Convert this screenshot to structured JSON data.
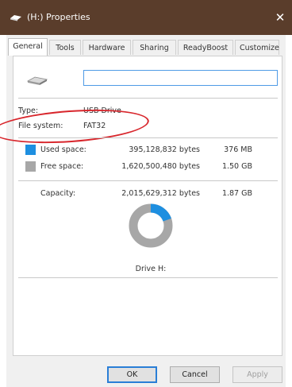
{
  "window": {
    "title": "(H:) Properties",
    "close_glyph": "✕",
    "icon": "drive-icon",
    "titlebar_color": "#5a3d2b"
  },
  "tabs": [
    {
      "label": "General",
      "active": true
    },
    {
      "label": "Tools"
    },
    {
      "label": "Hardware"
    },
    {
      "label": "Sharing"
    },
    {
      "label": "ReadyBoost"
    },
    {
      "label": "Customize"
    }
  ],
  "general": {
    "drive_icon": "drive-icon",
    "name_value": "",
    "type_label": "Type:",
    "type_value": "USB Drive",
    "fs_label": "File system:",
    "fs_value": "FAT32",
    "used": {
      "label": "Used space:",
      "bytes": "395,128,832 bytes",
      "size": "376 MB",
      "color": "#1e8fe0"
    },
    "free": {
      "label": "Free space:",
      "bytes": "1,620,500,480 bytes",
      "size": "1.50 GB",
      "color": "#a7a7a7"
    },
    "capacity": {
      "label": "Capacity:",
      "bytes": "2,015,629,312 bytes",
      "size": "1.87 GB"
    },
    "drive_label": "Drive H:",
    "used_fraction": 0.196,
    "annotation_color": "#d8262c"
  },
  "buttons": {
    "ok": "OK",
    "cancel": "Cancel",
    "apply": "Apply"
  }
}
